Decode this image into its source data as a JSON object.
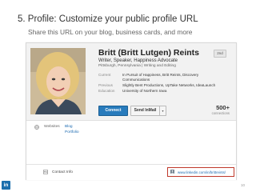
{
  "slide": {
    "title": "5.  Profile: Customize your public profile URL",
    "subtitle": "Share this URL on your blog, business cards, and more",
    "page_number": "10"
  },
  "profile": {
    "name": "Britt (Britt Lutgen) Reints",
    "connection_degree": "2nd",
    "headline": "Writer, Speaker, Happiness Advocate",
    "location": "Pittsburgh, Pennsylvania  |  Writing and Editing",
    "rows": [
      {
        "label": "Current",
        "value": "In Pursuit of Happiness, Britt Reints, Discovery"
      },
      {
        "label": "",
        "value": "Communications"
      },
      {
        "label": "Previous",
        "value": "Slightly Bent Productions, UpTake Networks, IdeaLaunch"
      },
      {
        "label": "Education",
        "value": "University of Northern Iowa"
      }
    ],
    "connect_label": "Connect",
    "inmail_label": "Send InMail",
    "dropdown_glyph": "▾",
    "connections_count": "500+",
    "connections_label": "connections",
    "websites_label": "Websites",
    "websites": [
      "Blog",
      "Portfolio"
    ],
    "contact_label": "Contact Info",
    "public_url": "www.linkedin.com/in/brittreints/"
  },
  "brand": {
    "logo_text": "in",
    "accent": "#287bbc",
    "highlight": "#c0392b"
  },
  "icons": {
    "websites": "globe-icon",
    "contact": "contact-card-icon",
    "url": "linkedin-profile-icon"
  }
}
